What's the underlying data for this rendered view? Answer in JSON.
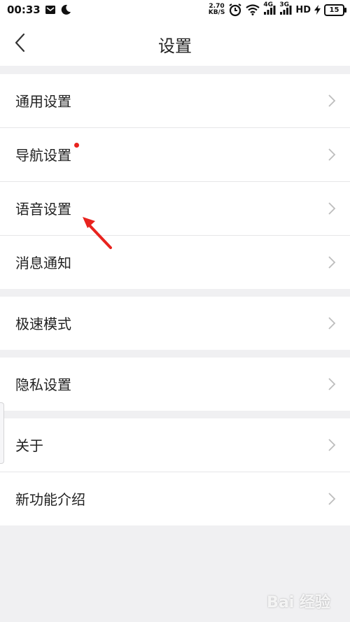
{
  "status_bar": {
    "time": "00:33",
    "net_speed_value": "2.70",
    "net_speed_unit": "KB/S",
    "sig1": "4G",
    "sig2": "3G",
    "hd": "HD",
    "battery": "15"
  },
  "nav": {
    "title": "设置"
  },
  "groups": [
    {
      "items": [
        {
          "label": "通用设置"
        },
        {
          "label": "导航设置",
          "badge": true
        },
        {
          "label": "语音设置"
        },
        {
          "label": "消息通知"
        }
      ]
    },
    {
      "items": [
        {
          "label": "极速模式"
        }
      ]
    },
    {
      "items": [
        {
          "label": "隐私设置"
        }
      ]
    },
    {
      "items": [
        {
          "label": "关于"
        },
        {
          "label": "新功能介绍"
        }
      ]
    }
  ],
  "watermark": "Bai 经验",
  "colors": {
    "accent_red": "#e8231e",
    "background": "#f0f0f2"
  }
}
